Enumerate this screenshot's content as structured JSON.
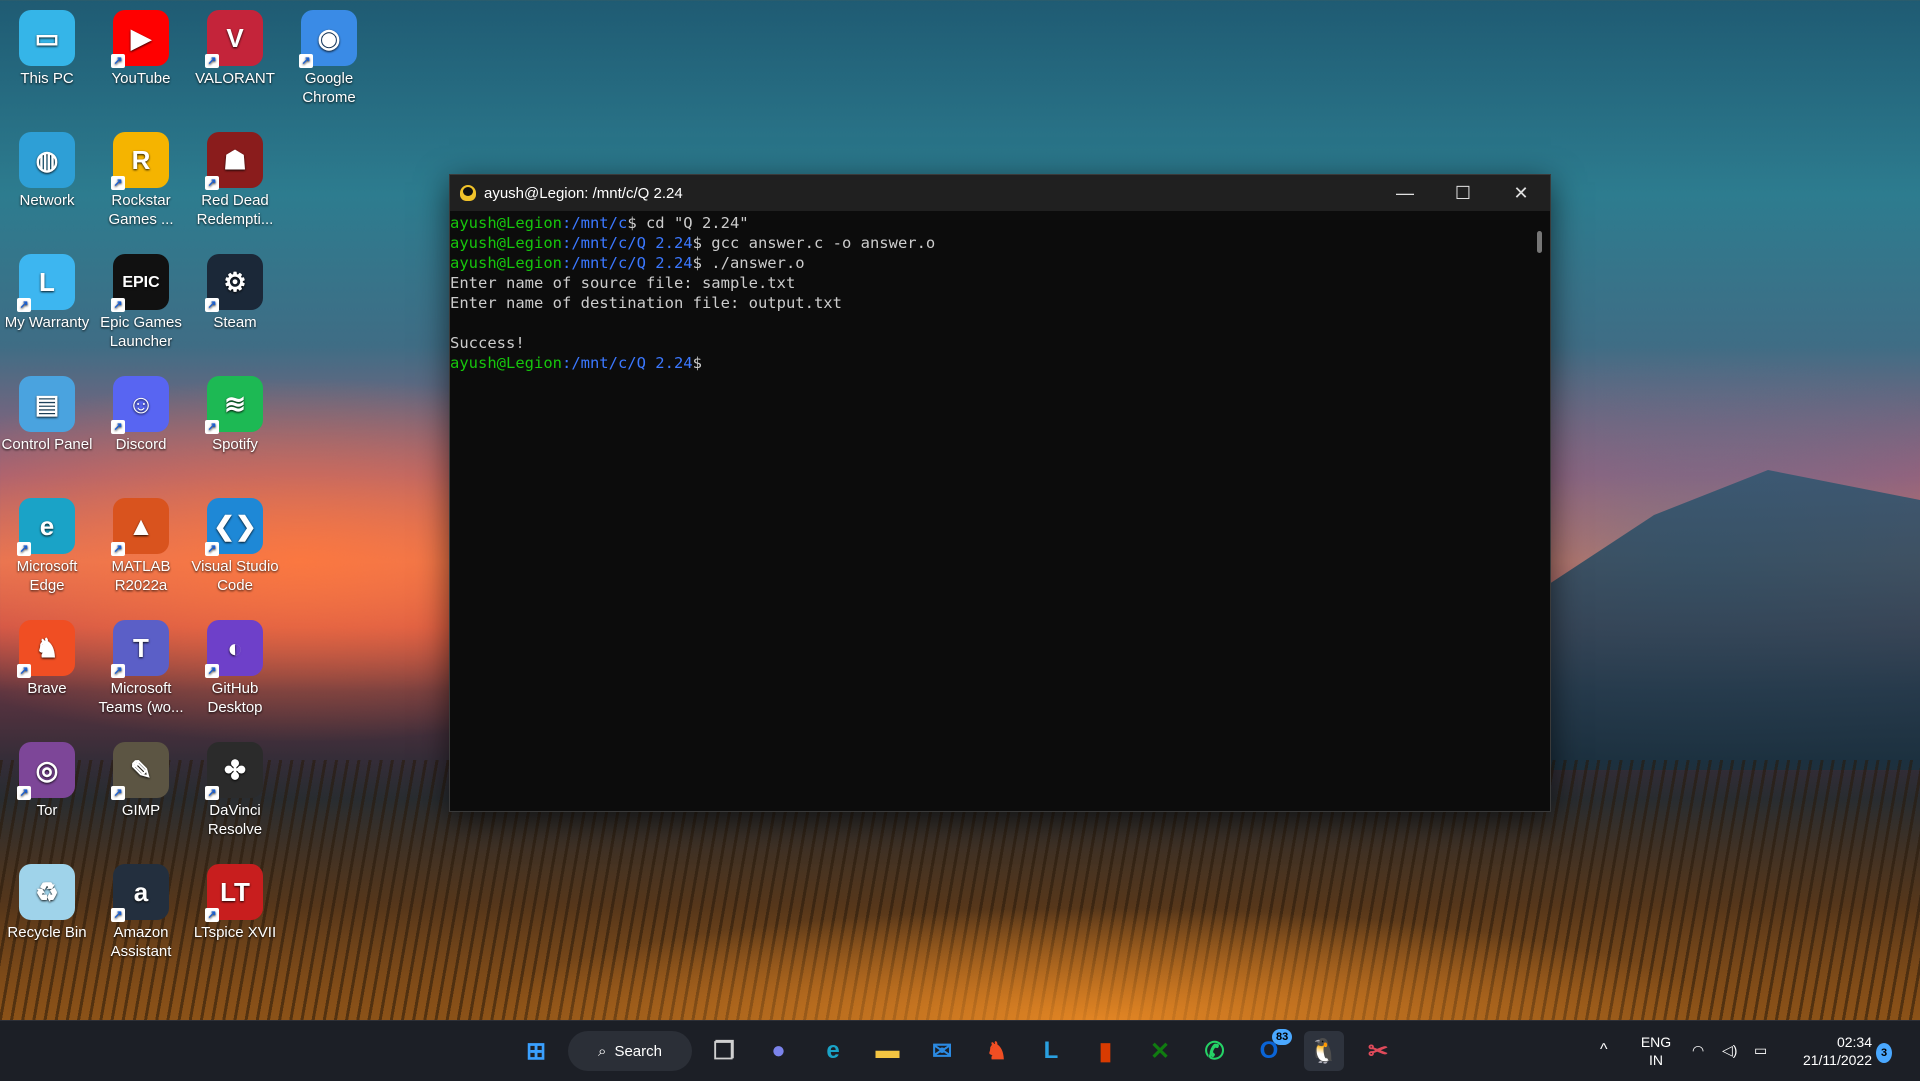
{
  "desktop": {
    "icons": [
      {
        "label": "This PC",
        "icon": "monitor-icon",
        "color": "#35b5e8",
        "glyph": "▭",
        "shortcut": false
      },
      {
        "label": "YouTube",
        "icon": "youtube-icon",
        "color": "#ff0000",
        "glyph": "▶",
        "shortcut": true
      },
      {
        "label": "VALORANT",
        "icon": "valorant-icon",
        "color": "#c4243a",
        "glyph": "V",
        "shortcut": true
      },
      {
        "label": "Google Chrome",
        "icon": "chrome-icon",
        "color": "#3a8be6",
        "glyph": "◉",
        "shortcut": true
      },
      {
        "label": "Network",
        "icon": "network-icon",
        "color": "#2e9fd6",
        "glyph": "◍",
        "shortcut": false
      },
      {
        "label": "Rockstar Games ...",
        "icon": "rockstar-icon",
        "color": "#f5b400",
        "glyph": "R",
        "shortcut": true
      },
      {
        "label": "Red Dead Redempti...",
        "icon": "red-dead-icon",
        "color": "#8a1c1c",
        "glyph": "☗",
        "shortcut": true
      },
      {
        "label": "My Warranty",
        "icon": "warranty-icon",
        "color": "#3db6f0",
        "glyph": "L",
        "shortcut": true
      },
      {
        "label": "Epic Games Launcher",
        "icon": "epic-games-icon",
        "color": "#111111",
        "glyph": "EPIC",
        "shortcut": true
      },
      {
        "label": "Steam",
        "icon": "steam-icon",
        "color": "#1b2838",
        "glyph": "⚙",
        "shortcut": true
      },
      {
        "label": "Control Panel",
        "icon": "control-panel-icon",
        "color": "#4aa3df",
        "glyph": "▤",
        "shortcut": false
      },
      {
        "label": "Discord",
        "icon": "discord-icon",
        "color": "#5865f2",
        "glyph": "☺",
        "shortcut": true
      },
      {
        "label": "Spotify",
        "icon": "spotify-icon",
        "color": "#1db954",
        "glyph": "≋",
        "shortcut": true
      },
      {
        "label": "Microsoft Edge",
        "icon": "edge-icon",
        "color": "#1aa3c7",
        "glyph": "e",
        "shortcut": true
      },
      {
        "label": "MATLAB R2022a",
        "icon": "matlab-icon",
        "color": "#d9531e",
        "glyph": "▲",
        "shortcut": true
      },
      {
        "label": "Visual Studio Code",
        "icon": "vscode-icon",
        "color": "#1e88d6",
        "glyph": "❮❯",
        "shortcut": true
      },
      {
        "label": "Brave",
        "icon": "brave-icon",
        "color": "#f04e23",
        "glyph": "♞",
        "shortcut": true
      },
      {
        "label": "Microsoft Teams (wo...",
        "icon": "teams-icon",
        "color": "#5b5fc7",
        "glyph": "T",
        "shortcut": true
      },
      {
        "label": "GitHub Desktop",
        "icon": "github-icon",
        "color": "#6e40c9",
        "glyph": "◐",
        "shortcut": true
      },
      {
        "label": "Tor",
        "icon": "tor-icon",
        "color": "#7d4698",
        "glyph": "◎",
        "shortcut": true
      },
      {
        "label": "GIMP",
        "icon": "gimp-icon",
        "color": "#5c5543",
        "glyph": "✎",
        "shortcut": true
      },
      {
        "label": "DaVinci Resolve",
        "icon": "davinci-icon",
        "color": "#2b2b2b",
        "glyph": "✤",
        "shortcut": true
      },
      {
        "label": "Recycle Bin",
        "icon": "recycle-bin-icon",
        "color": "#9fd3ea",
        "glyph": "♻",
        "shortcut": false
      },
      {
        "label": "Amazon Assistant",
        "icon": "amazon-icon",
        "color": "#232f3e",
        "glyph": "a",
        "shortcut": true
      },
      {
        "label": "LTspice XVII",
        "icon": "ltspice-icon",
        "color": "#c81e1e",
        "glyph": "LT",
        "shortcut": true
      }
    ]
  },
  "terminal": {
    "title": "ayush@Legion: /mnt/c/Q 2.24",
    "lines": [
      {
        "user": "ayush@Legion",
        "path": ":/mnt/c",
        "rest": "$ cd \"Q 2.24\""
      },
      {
        "user": "ayush@Legion",
        "path": ":/mnt/c/Q 2.24",
        "rest": "$ gcc answer.c -o answer.o"
      },
      {
        "user": "ayush@Legion",
        "path": ":/mnt/c/Q 2.24",
        "rest": "$ ./answer.o"
      },
      {
        "user": "",
        "path": "",
        "rest": "Enter name of source file: sample.txt"
      },
      {
        "user": "",
        "path": "",
        "rest": "Enter name of destination file: output.txt"
      },
      {
        "user": "",
        "path": "",
        "rest": ""
      },
      {
        "user": "",
        "path": "",
        "rest": "Success!"
      },
      {
        "user": "ayush@Legion",
        "path": ":/mnt/c/Q 2.24",
        "rest": "$"
      }
    ],
    "minimize_glyph": "—",
    "maximize_glyph": "☐",
    "close_glyph": "✕"
  },
  "taskbar": {
    "search_label": "Search",
    "apps": [
      {
        "name": "start-button",
        "icon": "windows-icon",
        "color": "#3aa0ff",
        "glyph": "⊞"
      },
      {
        "name": "task-view-button",
        "icon": "task-view-icon",
        "color": "#d0d0d0",
        "glyph": "❐"
      },
      {
        "name": "chat-button",
        "icon": "chat-icon",
        "color": "#7b83eb",
        "glyph": "●"
      },
      {
        "name": "edge-taskbar",
        "icon": "edge-icon",
        "color": "#1aa3c7",
        "glyph": "e"
      },
      {
        "name": "file-explorer-taskbar",
        "icon": "folder-icon",
        "color": "#f4c542",
        "glyph": "▬"
      },
      {
        "name": "mail-taskbar",
        "icon": "mail-icon",
        "color": "#2b8ae2",
        "glyph": "✉"
      },
      {
        "name": "brave-taskbar",
        "icon": "brave-icon",
        "color": "#f04e23",
        "glyph": "♞"
      },
      {
        "name": "lenovo-vantage-taskbar",
        "icon": "vantage-icon",
        "color": "#2aa0e0",
        "glyph": "L"
      },
      {
        "name": "office-taskbar",
        "icon": "office-icon",
        "color": "#d83b01",
        "glyph": "▮"
      },
      {
        "name": "xbox-taskbar",
        "icon": "xbox-icon",
        "color": "#107c10",
        "glyph": "✕"
      },
      {
        "name": "whatsapp-taskbar",
        "icon": "whatsapp-icon",
        "color": "#25d366",
        "glyph": "✆"
      },
      {
        "name": "outlook-taskbar",
        "icon": "outlook-icon",
        "color": "#0a64d6",
        "glyph": "O"
      },
      {
        "name": "wsl-terminal-taskbar",
        "icon": "tux-icon",
        "color": "#3a6fa8",
        "glyph": "🐧"
      },
      {
        "name": "snipping-tool-taskbar",
        "icon": "snipping-icon",
        "color": "#e04a5a",
        "glyph": "✂"
      }
    ],
    "outlook_badge": "83",
    "lang_top": "ENG",
    "lang_bottom": "IN",
    "time": "02:34",
    "date": "21/11/2022",
    "notification_count": "3",
    "chevron_glyph": "^"
  }
}
